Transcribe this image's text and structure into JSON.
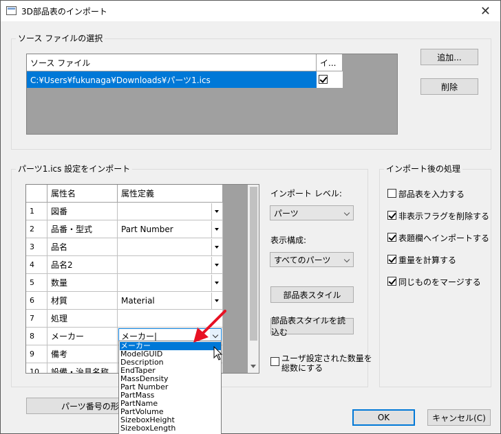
{
  "window": {
    "title": "3D部品表のインポート",
    "close_glyph": "✕"
  },
  "source_group": {
    "legend": "ソース ファイルの選択",
    "columns": [
      "ソース ファイル",
      "イ..."
    ],
    "rows": [
      {
        "path": "C:¥Users¥fukunaga¥Downloads¥パーツ1.ics",
        "checked": true
      }
    ],
    "add_label": "追加...",
    "delete_label": "削除"
  },
  "import_group": {
    "legend": "パーツ1.ics 設定をインポート",
    "columns": [
      "属性名",
      "属性定義"
    ],
    "rows": [
      {
        "num": "1",
        "name": "図番",
        "def": ""
      },
      {
        "num": "2",
        "name": "品番・型式",
        "def": "Part Number"
      },
      {
        "num": "3",
        "name": "品名",
        "def": ""
      },
      {
        "num": "4",
        "name": "品名2",
        "def": ""
      },
      {
        "num": "5",
        "name": "数量",
        "def": ""
      },
      {
        "num": "6",
        "name": "材質",
        "def": "Material"
      },
      {
        "num": "7",
        "name": "処理",
        "def": ""
      },
      {
        "num": "8",
        "name": "メーカー",
        "def": "メーカー|"
      },
      {
        "num": "9",
        "name": "備考",
        "def": ""
      },
      {
        "num": "10",
        "name": "設備・治具名称",
        "def": ""
      }
    ],
    "dropdown_options": [
      "メーカー",
      "ModelGUID",
      "Description",
      "EndTaper",
      "MassDensity",
      "Part Number",
      "PartMass",
      "PartName",
      "PartVolume",
      "SizeboxHeight",
      "SizeboxLength"
    ],
    "dropdown_selected": "メーカー",
    "level_label": "インポート レベル:",
    "level_value": "パーツ",
    "display_label": "表示構成:",
    "display_value": "すべてのパーツ",
    "bom_style_label": "部品表スタイル",
    "load_style_label": "部品表スタイルを読込む",
    "user_qty_label": "ユーザ設定された数量を\n総数にする",
    "user_qty_checked": false
  },
  "post_group": {
    "legend": "インポート後の処理",
    "options": [
      {
        "label": "部品表を入力する",
        "checked": false
      },
      {
        "label": "非表示フラグを削除する",
        "checked": true
      },
      {
        "label": "表題欄へインポートする",
        "checked": true
      },
      {
        "label": "重量を計算する",
        "checked": true
      },
      {
        "label": "同じものをマージする",
        "checked": true
      }
    ]
  },
  "part_number_label": "パーツ番号の形状",
  "ok_label": "OK",
  "cancel_label": "キャンセル(C)"
}
